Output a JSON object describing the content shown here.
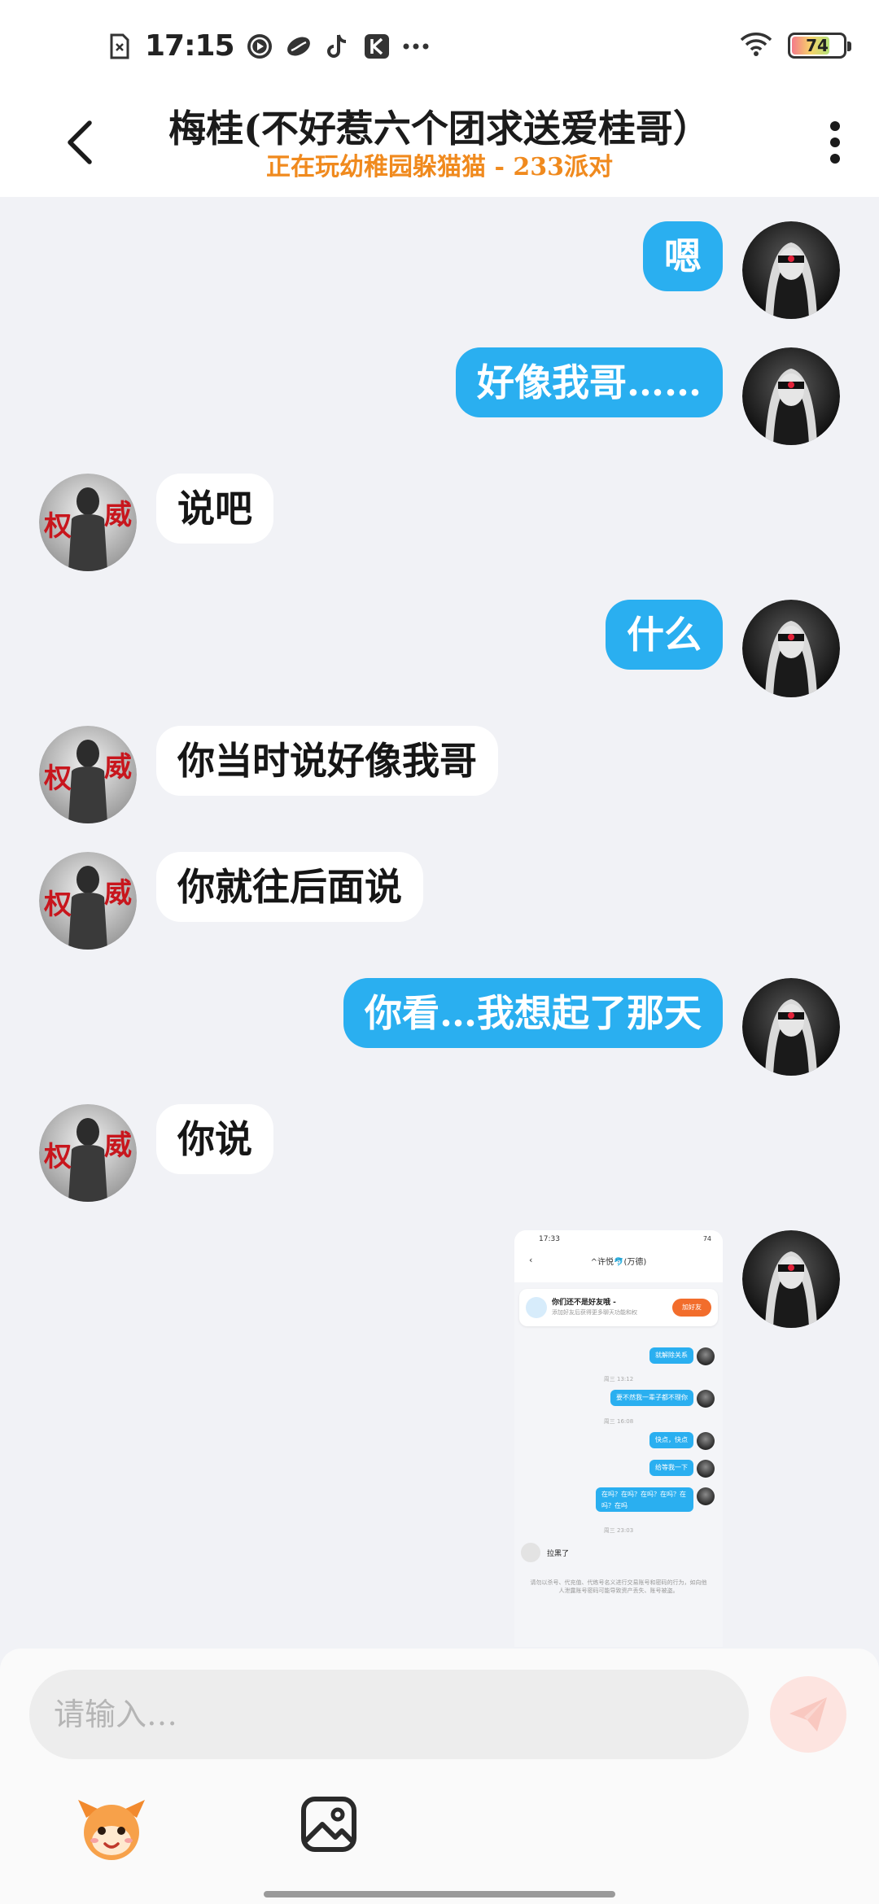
{
  "status_bar": {
    "time": "17:15",
    "battery": "74",
    "battery_level": 0.74,
    "icons": [
      "sim-card-icon",
      "video-app-icon",
      "bird-app-icon",
      "tiktok-icon",
      "k-app-icon",
      "more-dots-icon",
      "wifi-icon",
      "battery-icon"
    ]
  },
  "header": {
    "title": "梅桂(不好惹六个团求送爱桂哥）",
    "subtitle": "正在玩幼稚园躲猫猫 - 233派对"
  },
  "messages": [
    {
      "side": "out",
      "text": "嗯"
    },
    {
      "side": "out",
      "text": "好像我哥……"
    },
    {
      "side": "in",
      "text": "说吧"
    },
    {
      "side": "out",
      "text": "什么"
    },
    {
      "side": "in",
      "text": "你当时说好像我哥"
    },
    {
      "side": "in",
      "text": "你就往后面说"
    },
    {
      "side": "out",
      "text": "你看…我想起了那天"
    },
    {
      "side": "in",
      "text": "你说"
    }
  ],
  "screenshot": {
    "time": "17:33",
    "title": "^许悦🐬(万德)",
    "banner_title": "你们还不是好友哦 -",
    "banner_sub": "添加好友后获得更多聊天功能和权",
    "banner_button": "加好友",
    "items": [
      {
        "type": "out",
        "text": "就解除关系"
      },
      {
        "type": "time",
        "text": "周三 13:12"
      },
      {
        "type": "out",
        "text": "要不然我一辈子都不理你"
      },
      {
        "type": "time",
        "text": "周三 16:08"
      },
      {
        "type": "out",
        "text": "快点，快点"
      },
      {
        "type": "out",
        "text": "给等我一下"
      },
      {
        "type": "out",
        "text": "在吗？在吗？在吗？在吗？在吗？在吗"
      },
      {
        "type": "time",
        "text": "周三 23:03"
      },
      {
        "type": "in",
        "text": "拉黑了"
      }
    ],
    "note": "请勿以杀号、代充值、代练号名义进行交易账号和密码的行为，如向他人泄露账号密码可能导致资产丢失、账号被盗。"
  },
  "input": {
    "placeholder": "请输入…"
  },
  "colors": {
    "outgoing_bubble": "#2aaff0",
    "incoming_bubble": "#ffffff",
    "subtitle": "#f08a1e",
    "background": "#f1f2f6"
  }
}
